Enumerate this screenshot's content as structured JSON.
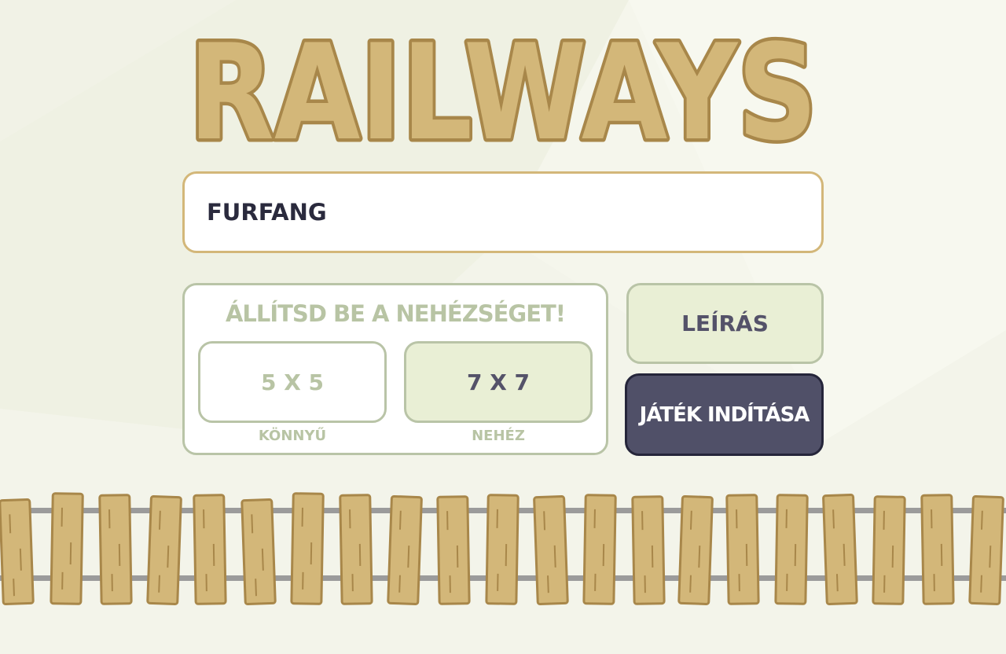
{
  "logo": {
    "text": "RAILWAYS"
  },
  "player": {
    "name_value": "FURFANG"
  },
  "difficulty": {
    "title": "ÁLLÍTSD BE A NEHÉZSÉGET!",
    "options": [
      {
        "label": "5 X 5",
        "caption": "KÖNNYŰ",
        "selected": false
      },
      {
        "label": "7 X 7",
        "caption": "NEHÉZ",
        "selected": true
      }
    ]
  },
  "actions": {
    "rules_label": "LEÍRÁS",
    "start_label": "JÁTÉK INDÍTÁSA"
  },
  "colors": {
    "background": "#f5f6ec",
    "wood": "#d3b779",
    "wood_outline": "#a8874a",
    "rail": "#9b9b9b",
    "sage": "#b9c4a7",
    "sage_fill": "#e9efd5",
    "dark_button": "#505068"
  }
}
